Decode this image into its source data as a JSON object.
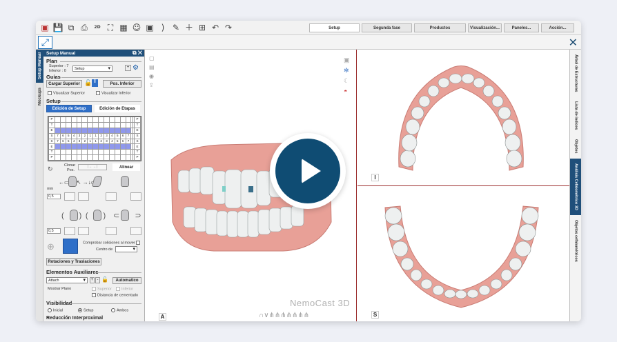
{
  "toolbar": {
    "menus": [
      "Setup",
      "Segunda fase",
      "Productos",
      "Visualización...",
      "Paneles...",
      "Acción..."
    ],
    "view_2d_label": "2D"
  },
  "panel": {
    "title": "Setup Manual",
    "tabs": [
      "Setup Manual",
      "Mockups"
    ],
    "plan": {
      "heading": "Plan",
      "superior": "Superior : 7",
      "inferior": "Inferior : 0",
      "select_value": "Setup"
    },
    "guias": {
      "heading": "Guías",
      "cargar_superior": "Cargar Superior",
      "pos_inferior": "Pos. Inferior",
      "visualizar_superior": "Visualizar Superior",
      "visualizar_inferior": "Visualizar Inferior"
    },
    "setup": {
      "heading": "Setup",
      "tab_edicion_setup": "Edición de Setup",
      "tab_edicion_etapas": "Edición de Etapas",
      "grid_rows": [
        [
          "P",
          "",
          "",
          "",
          "",
          "",
          "",
          "",
          "",
          "",
          "",
          "",
          "",
          "",
          "",
          "",
          "",
          "P"
        ],
        [
          "T",
          "",
          "",
          "",
          "",
          "",
          "",
          "",
          "",
          "",
          "",
          "",
          "",
          "",
          "",
          "",
          "",
          "T"
        ],
        [
          "E",
          "",
          "",
          "",
          "",
          "",
          "",
          "",
          "",
          "",
          "",
          "",
          "",
          "",
          "",
          "",
          "",
          "E"
        ],
        [
          "S",
          "7",
          "6",
          "5",
          "4",
          "3",
          "2",
          "1",
          "1",
          "2",
          "3",
          "4",
          "5",
          "6",
          "7",
          "",
          "",
          "S"
        ],
        [
          "S",
          "7",
          "6",
          "5",
          "4",
          "3",
          "2",
          "1",
          "1",
          "2",
          "3",
          "4",
          "5",
          "6",
          "7",
          "",
          "",
          "S"
        ],
        [
          "E",
          "",
          "",
          "",
          "",
          "",
          "",
          "",
          "",
          "",
          "",
          "",
          "",
          "",
          "",
          "",
          "",
          "E"
        ],
        [
          "T",
          "",
          "",
          "",
          "",
          "",
          "",
          "",
          "",
          "",
          "",
          "",
          "",
          "",
          "",
          "",
          "",
          "T"
        ],
        [
          "P",
          "",
          "",
          "",
          "",
          "",
          "",
          "",
          "",
          "",
          "",
          "",
          "",
          "",
          "",
          "",
          "",
          "P"
        ]
      ],
      "clonar": "Clonar",
      "pos": "Pos.",
      "alinear": "Alinear",
      "mm": "mm",
      "step1": "0,5",
      "step2": "0,5",
      "comprobar": "Comprobar colisiones al mover",
      "centro_de": "Centro de",
      "rotaciones": "Rotaciones y Traslaciones"
    },
    "auxiliares": {
      "heading": "Elementos Auxiliares",
      "attach": "Attach",
      "automatico": "Automatico",
      "mostrar_plano": "Mostrar Plano",
      "superior": "Superior",
      "inferior": "Inferior",
      "distancia": "Distancia de cementado"
    },
    "visibilidad": {
      "heading": "Visibilidad",
      "options": [
        "Inicial",
        "Setup",
        "Ambos"
      ]
    },
    "reduccion": "Reducción Interproximal"
  },
  "views": {
    "main_label": "A",
    "top_label": "I",
    "bottom_label": "S",
    "watermark": "NemoCast 3D"
  },
  "right_tabs": [
    "Árbol de Estructuras",
    "Lista de índices",
    "Objetos",
    "Análisis Cefalométrico 3D",
    "Objetos cefalométricos"
  ],
  "colors": {
    "accent": "#1f4f7a",
    "play": "#0f4c73",
    "gum": "#e59a92",
    "tooth": "#eef0f0"
  }
}
